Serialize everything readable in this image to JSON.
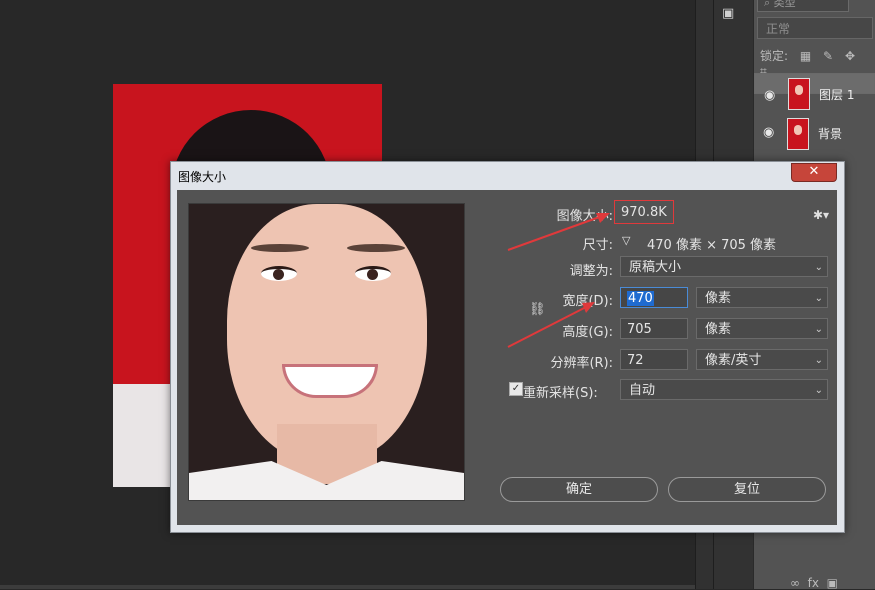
{
  "layers_panel": {
    "filter_placeholder": "类型",
    "blend_mode": "正常",
    "lock_label": "锁定:",
    "layers": [
      {
        "name": "图层 1",
        "selected": true
      },
      {
        "name": "背景",
        "selected": false
      }
    ],
    "footer_fx": "fx"
  },
  "dialog": {
    "title": "图像大小",
    "close_label": "✕",
    "image_size_label": "图像大小:",
    "image_size_value": "970.8K",
    "dimensions_label": "尺寸:",
    "dimensions_value": "470 像素 × 705 像素",
    "fit_to_label": "调整为:",
    "fit_to_value": "原稿大小",
    "width_label": "宽度(D):",
    "width_value": "470",
    "width_unit": "像素",
    "height_label": "高度(G):",
    "height_value": "705",
    "height_unit": "像素",
    "resolution_label": "分辨率(R):",
    "resolution_value": "72",
    "resolution_unit": "像素/英寸",
    "resample_label": "重新采样(S):",
    "resample_checked": true,
    "resample_value": "自动",
    "ok_label": "确定",
    "reset_label": "复位"
  },
  "colors": {
    "annotation_red": "#e0393b",
    "focus_blue": "#4a8bd6"
  }
}
